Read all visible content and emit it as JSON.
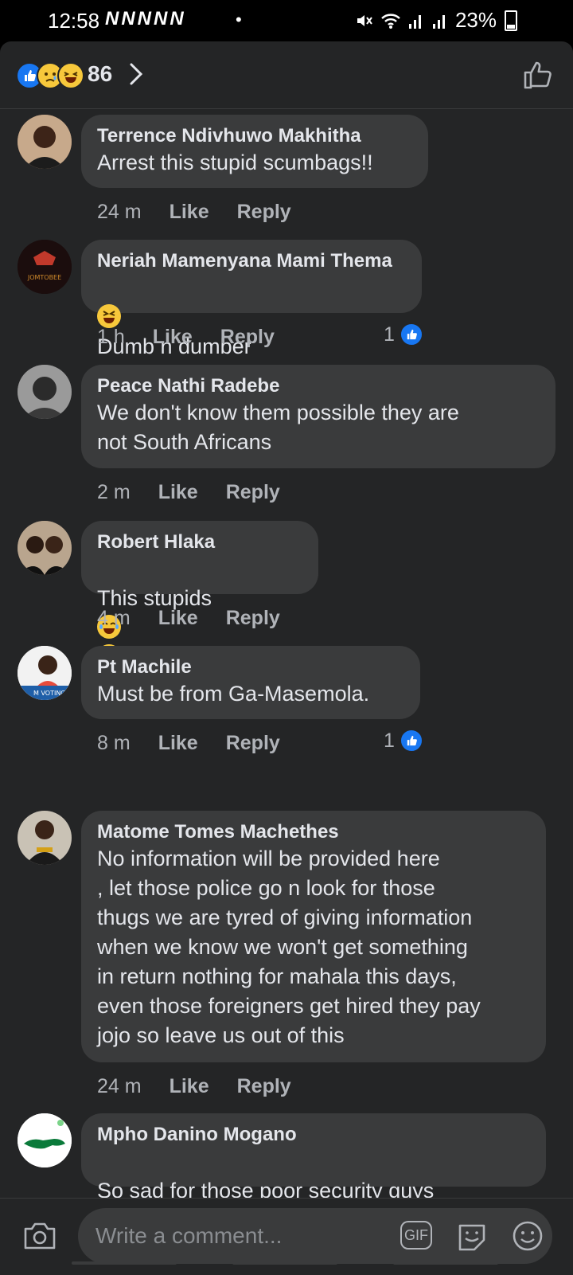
{
  "status": {
    "time": "12:58",
    "notifications": "NNNNN",
    "dot": "•",
    "battery": "23%"
  },
  "header": {
    "reaction_count": "86"
  },
  "comments": [
    {
      "name": "Terrence Ndivhuwo Makhitha",
      "text": "Arrest this stupid scumbags!!",
      "time": "24 m",
      "like": "Like",
      "reply": "Reply"
    },
    {
      "name": "Neriah Mamenyana Mami Thema",
      "text": "Dumb n dumber",
      "time": "1 h",
      "like": "Like",
      "reply": "Reply",
      "likes": "1"
    },
    {
      "name": "Peace Nathi Radebe",
      "text": "We don't know them possible they are\nnot South Africans",
      "time": "2 m",
      "like": "Like",
      "reply": "Reply"
    },
    {
      "name": "Robert Hlaka",
      "text": "This stupids",
      "time": "4 m",
      "like": "Like",
      "reply": "Reply"
    },
    {
      "name": "Pt Machile",
      "text": "Must be from Ga-Masemola.",
      "time": "8 m",
      "like": "Like",
      "reply": "Reply",
      "likes": "1"
    },
    {
      "name": "Matome Tomes Machethes",
      "text": "No information will be provided here\n, let those police go n look for those\nthugs we are tyred of giving information\nwhen we know we won't get something\nin return nothing for mahala this days,\neven those foreigners get hired they pay\njojo so leave us out of this",
      "time": "24 m",
      "like": "Like",
      "reply": "Reply"
    },
    {
      "name": "Mpho Danino Mogano",
      "text": "So sad for those poor security guys"
    }
  ],
  "avatar_badges": {
    "neriah": "JOMTOBEE",
    "pt": "M VOTING"
  },
  "composer": {
    "placeholder": "Write a comment...",
    "gif": "GIF"
  },
  "colors": {
    "background": "#242526",
    "bubble": "#3a3b3c",
    "accent": "#1877f2"
  },
  "icons": [
    "like-reaction-icon",
    "sad-reaction-icon",
    "haha-reaction-icon",
    "chevron-right-icon",
    "thumbs-up-icon",
    "camera-icon",
    "gif-icon",
    "sticker-icon",
    "smiley-icon"
  ]
}
